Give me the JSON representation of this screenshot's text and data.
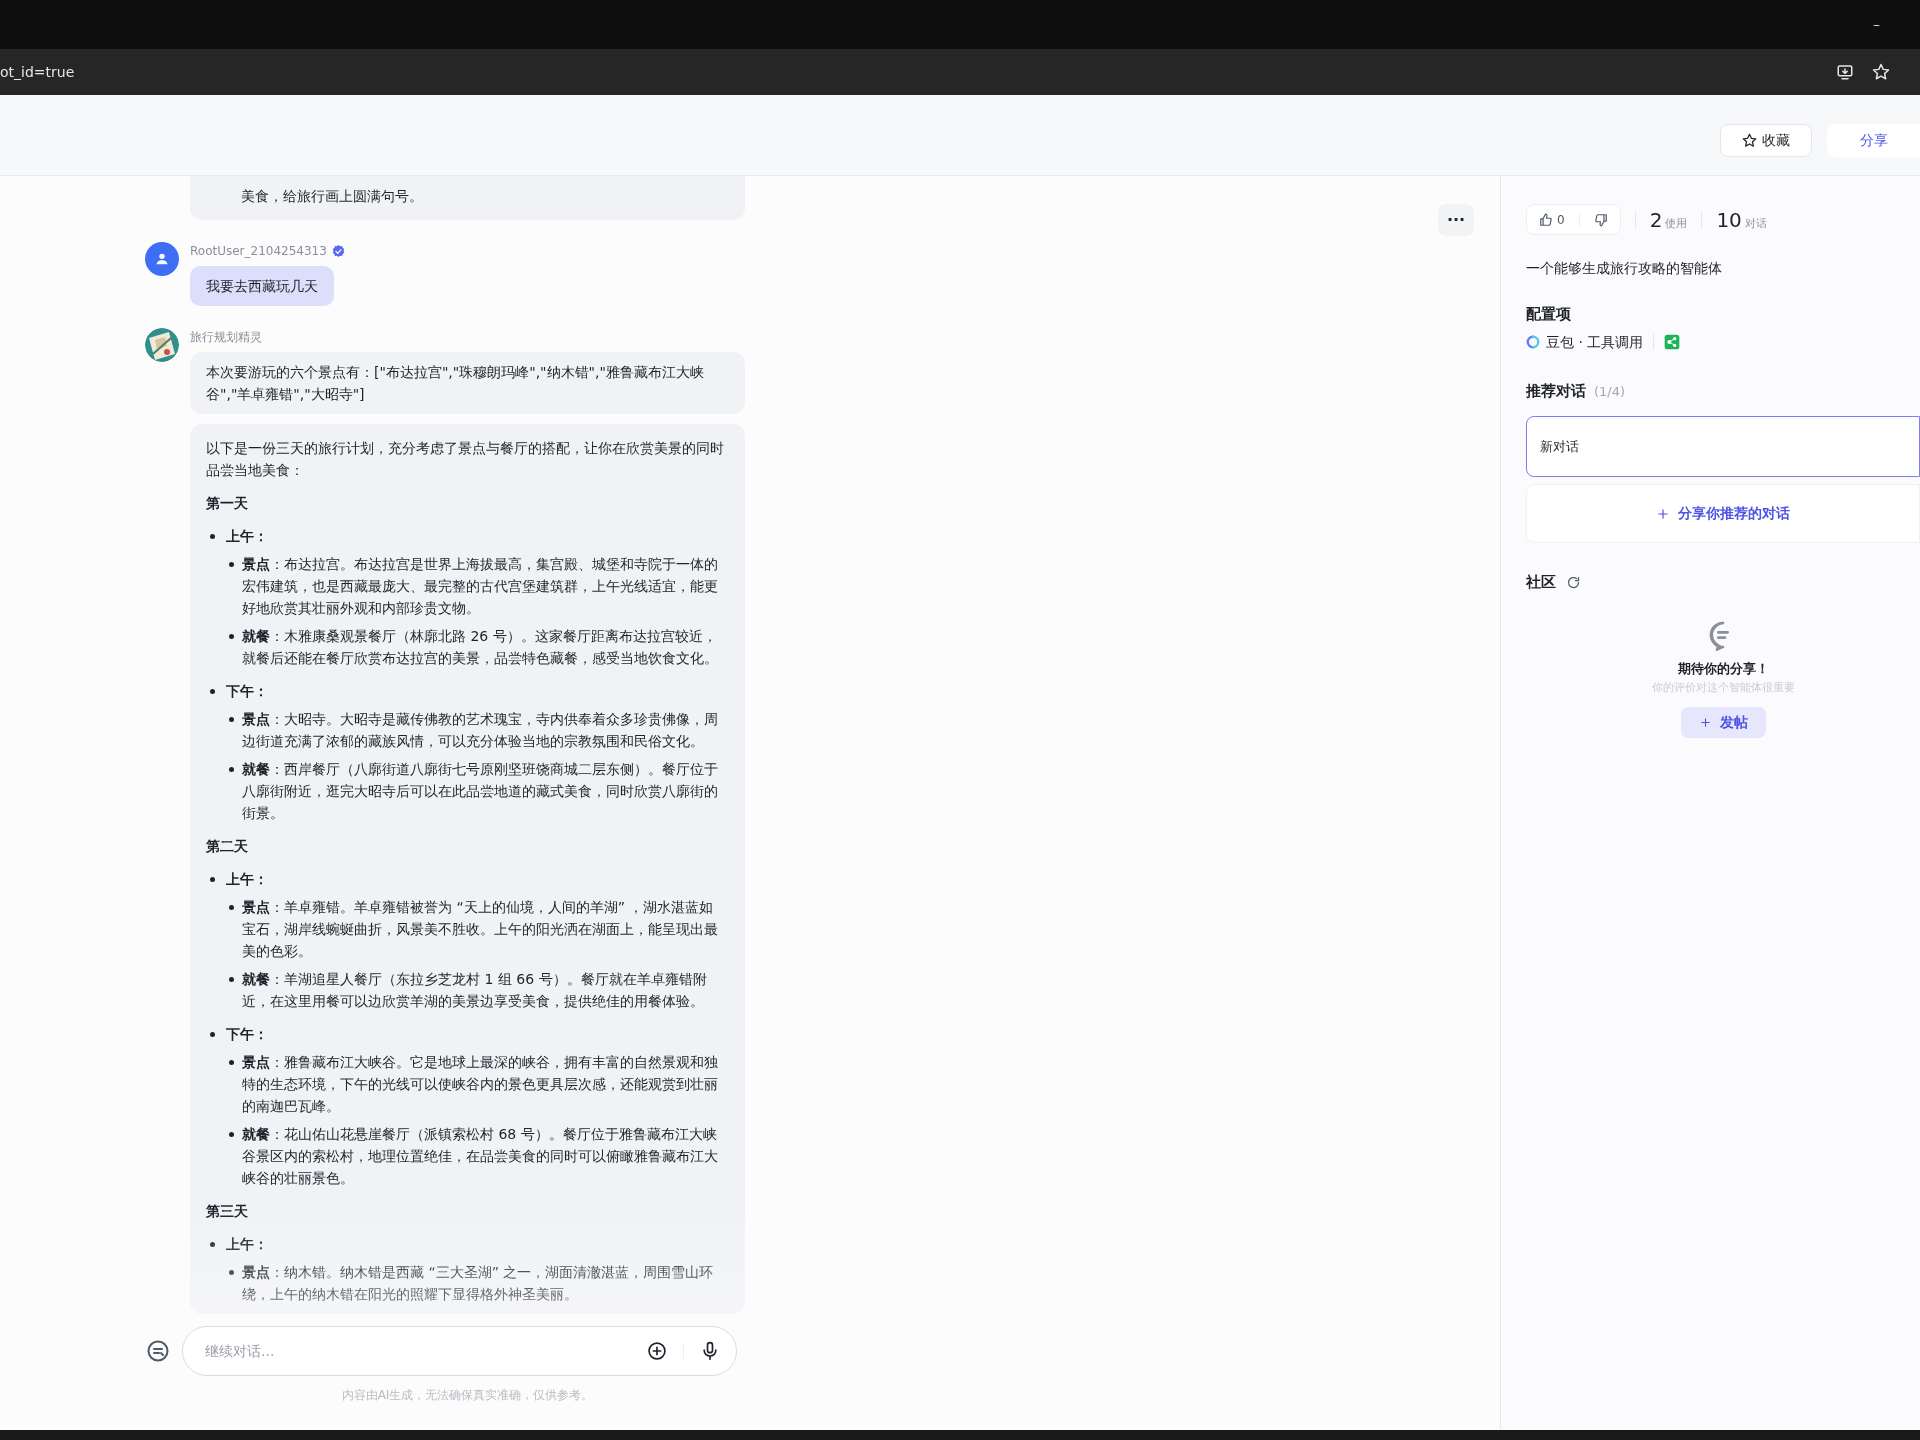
{
  "browser": {
    "address": "ot_id=true",
    "window_controls": [
      "–"
    ]
  },
  "header": {
    "buttons": [
      {
        "label": "收藏",
        "kind": "favorite"
      },
      {
        "label": "分享",
        "kind": "share"
      }
    ]
  },
  "chat": {
    "more_button": "···",
    "messages": [
      {
        "kind": "assistant",
        "bubbles": [
          {
            "blocks": [
              {
                "kind": "continuation",
                "text": "美食，给旅行画上圆满句号。"
              }
            ]
          }
        ]
      },
      {
        "kind": "user",
        "name": "RootUser_2104254313",
        "verified": true,
        "bubbles": [
          {
            "blocks": [
              {
                "kind": "text",
                "text": "我要去西藏玩几天"
              }
            ]
          }
        ]
      },
      {
        "kind": "assistant",
        "name": "旅行规划精灵",
        "bubbles": [
          {
            "blocks": [
              {
                "kind": "text",
                "text": "本次要游玩的六个景点有：[\"布达拉宫\",\"珠穆朗玛峰\",\"纳木错\",\"雅鲁藏布江大峡谷\",\"羊卓雍错\",\"大昭寺\"]"
              }
            ]
          },
          {
            "blocks": [
              {
                "kind": "text",
                "text": "以下是一份三天的旅行计划，充分考虑了景点与餐厅的搭配，让你在欣赏美景的同时品尝当地美食："
              },
              {
                "kind": "heading",
                "text": "第一天"
              },
              {
                "kind": "bullet",
                "text": "上午：",
                "children": [
                  {
                    "text": "**景点**：布达拉宫。布达拉宫是世界上海拔最高，集宫殿、城堡和寺院于一体的宏伟建筑，也是西藏最庞大、最完整的古代宫堡建筑群，上午光线适宜，能更好地欣赏其壮丽外观和内部珍贵文物。"
                  },
                  {
                    "text": "**就餐**：木雅康桑观景餐厅（林廓北路 26 号）。这家餐厅距离布达拉宫较近，就餐后还能在餐厅欣赏布达拉宫的美景，品尝特色藏餐，感受当地饮食文化。"
                  }
                ]
              },
              {
                "kind": "bullet",
                "text": "下午：",
                "children": [
                  {
                    "text": "**景点**：大昭寺。大昭寺是藏传佛教的艺术瑰宝，寺内供奉着众多珍贵佛像，周边街道充满了浓郁的藏族风情，可以充分体验当地的宗教氛围和民俗文化。"
                  },
                  {
                    "text": "**就餐**：西岸餐厅（八廓街道八廓街七号原刚坚班饶商城二层东侧）。餐厅位于八廓街附近，逛完大昭寺后可以在此品尝地道的藏式美食，同时欣赏八廓街的街景。"
                  }
                ]
              },
              {
                "kind": "heading",
                "text": "第二天"
              },
              {
                "kind": "bullet",
                "text": "上午：",
                "children": [
                  {
                    "text": "**景点**：羊卓雍错。羊卓雍错被誉为 “天上的仙境，人间的羊湖” ，湖水湛蓝如宝石，湖岸线蜿蜒曲折，风景美不胜收。上午的阳光洒在湖面上，能呈现出最美的色彩。"
                  },
                  {
                    "text": "**就餐**：羊湖追星人餐厅（东拉乡芝龙村 1 组 66 号）。餐厅就在羊卓雍错附近，在这里用餐可以边欣赏羊湖的美景边享受美食，提供绝佳的用餐体验。"
                  }
                ]
              },
              {
                "kind": "bullet",
                "text": "下午：",
                "children": [
                  {
                    "text": "**景点**：雅鲁藏布江大峡谷。它是地球上最深的峡谷，拥有丰富的自然景观和独特的生态环境，下午的光线可以使峡谷内的景色更具层次感，还能观赏到壮丽的南迦巴瓦峰。"
                  },
                  {
                    "text": "**就餐**：花山佑山花悬崖餐厅（派镇索松村 68 号）。餐厅位于雅鲁藏布江大峡谷景区内的索松村，地理位置绝佳，在品尝美食的同时可以俯瞰雅鲁藏布江大峡谷的壮丽景色。"
                  }
                ]
              },
              {
                "kind": "heading",
                "text": "第三天"
              },
              {
                "kind": "bullet",
                "text": "上午：",
                "children": [
                  {
                    "text": "**景点**：纳木错。纳木错是西藏 “三大圣湖” 之一，湖面清澈湛蓝，周围雪山环绕，上午的纳木错在阳光的照耀下显得格外神圣美丽。"
                  }
                ]
              }
            ]
          }
        ]
      }
    ],
    "input": {
      "placeholder": "继续对话..."
    },
    "disclaimer": "内容由AI生成，无法确保真实准确，仅供参考。"
  },
  "panel": {
    "likes": "0",
    "stats": [
      {
        "value": "2",
        "unit": "使用"
      },
      {
        "value": "10",
        "unit": "对话"
      }
    ],
    "description": "一个能够生成旅行攻略的智能体",
    "config": {
      "title": "配置项",
      "model": "豆包 · 工具调用"
    },
    "recommended": {
      "title": "推荐对话",
      "count": "(1/4)",
      "items": [
        {
          "text": "新对话",
          "selected": true
        }
      ],
      "add_label": "分享你推荐的对话"
    },
    "community": {
      "title": "社区",
      "empty_title": "期待你的分享！",
      "empty_subtitle": "你的评价对这个智能体很重要",
      "post_button": "发帖"
    }
  }
}
